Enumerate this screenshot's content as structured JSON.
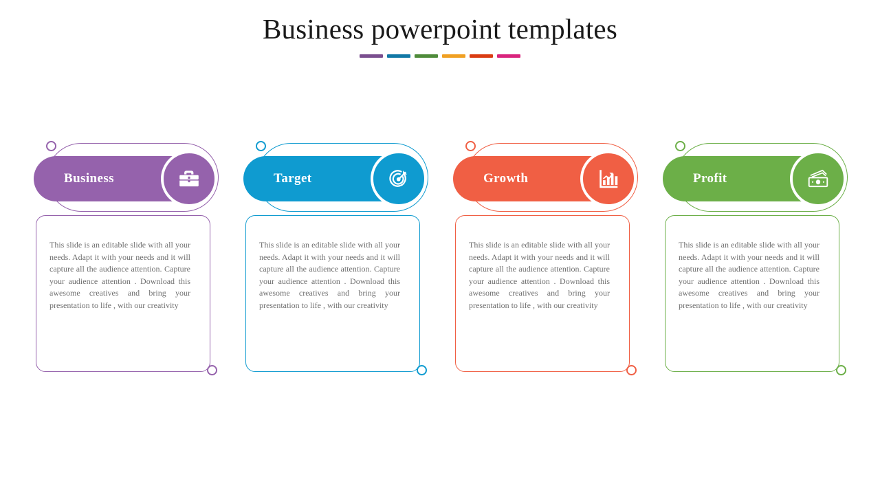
{
  "header": {
    "title": "Business powerpoint templates",
    "rule_bar_colors": [
      "#7A4E8F",
      "#1178A6",
      "#4E8B3A",
      "#F0A022",
      "#DA3C12",
      "#D9237D"
    ]
  },
  "cards": [
    {
      "label": "Business",
      "icon": "briefcase-icon",
      "color": "#9562AC",
      "body": "This slide is an editable slide with all your needs. Adapt it with your needs and it will capture all the audience attention. Capture your audience attention . Download this awesome creatives and bring your presentation to life , with our creativity"
    },
    {
      "label": "Target",
      "icon": "target-icon",
      "color": "#0F9BD0",
      "body": "This slide is an editable slide with all your needs. Adapt it with your needs and it will capture all the audience attention. Capture your audience attention . Download this awesome creatives and bring your presentation to life , with our creativity"
    },
    {
      "label": "Growth",
      "icon": "bar-chart-growth-icon",
      "color": "#F05F44",
      "body": "This slide is an editable slide with all your needs. Adapt it with your needs and it will capture all the audience attention. Capture your audience attention . Download this awesome creatives and bring your presentation to life , with our creativity"
    },
    {
      "label": "Profit",
      "icon": "banknotes-icon",
      "color": "#6CAF48",
      "body": "This slide is an editable slide with all your needs. Adapt it with your needs and it will capture all the audience attention. Capture your audience attention . Download this awesome creatives and bring your presentation to life , with our creativity"
    }
  ]
}
